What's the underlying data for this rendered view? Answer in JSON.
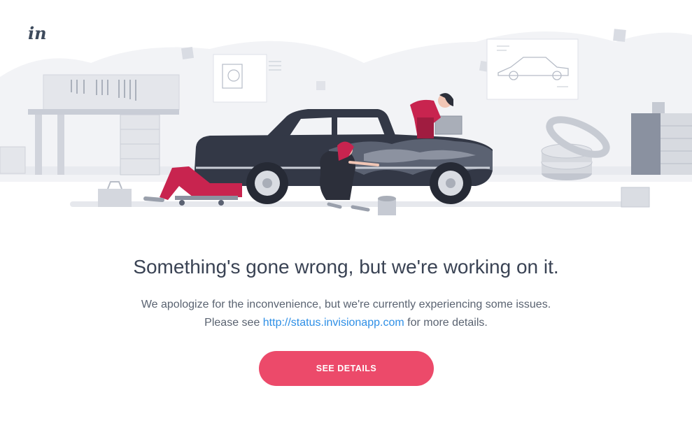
{
  "brand": {
    "logo_text": "in"
  },
  "error": {
    "headline": "Something's gone wrong, but we're working on it.",
    "line1": "We apologize for the inconvenience, but we're currently experiencing some issues.",
    "line2_before": "Please see ",
    "status_link": "http://status.invisionapp.com",
    "line2_after": " for more details."
  },
  "actions": {
    "see_details_label": "SEE DETAILS"
  },
  "colors": {
    "accent": "#ec4a6a",
    "link": "#2e8fe6",
    "heading": "#3a4354",
    "body_text": "#5a6371",
    "car_body": "#333846",
    "mechanic_red": "#c8244f"
  }
}
